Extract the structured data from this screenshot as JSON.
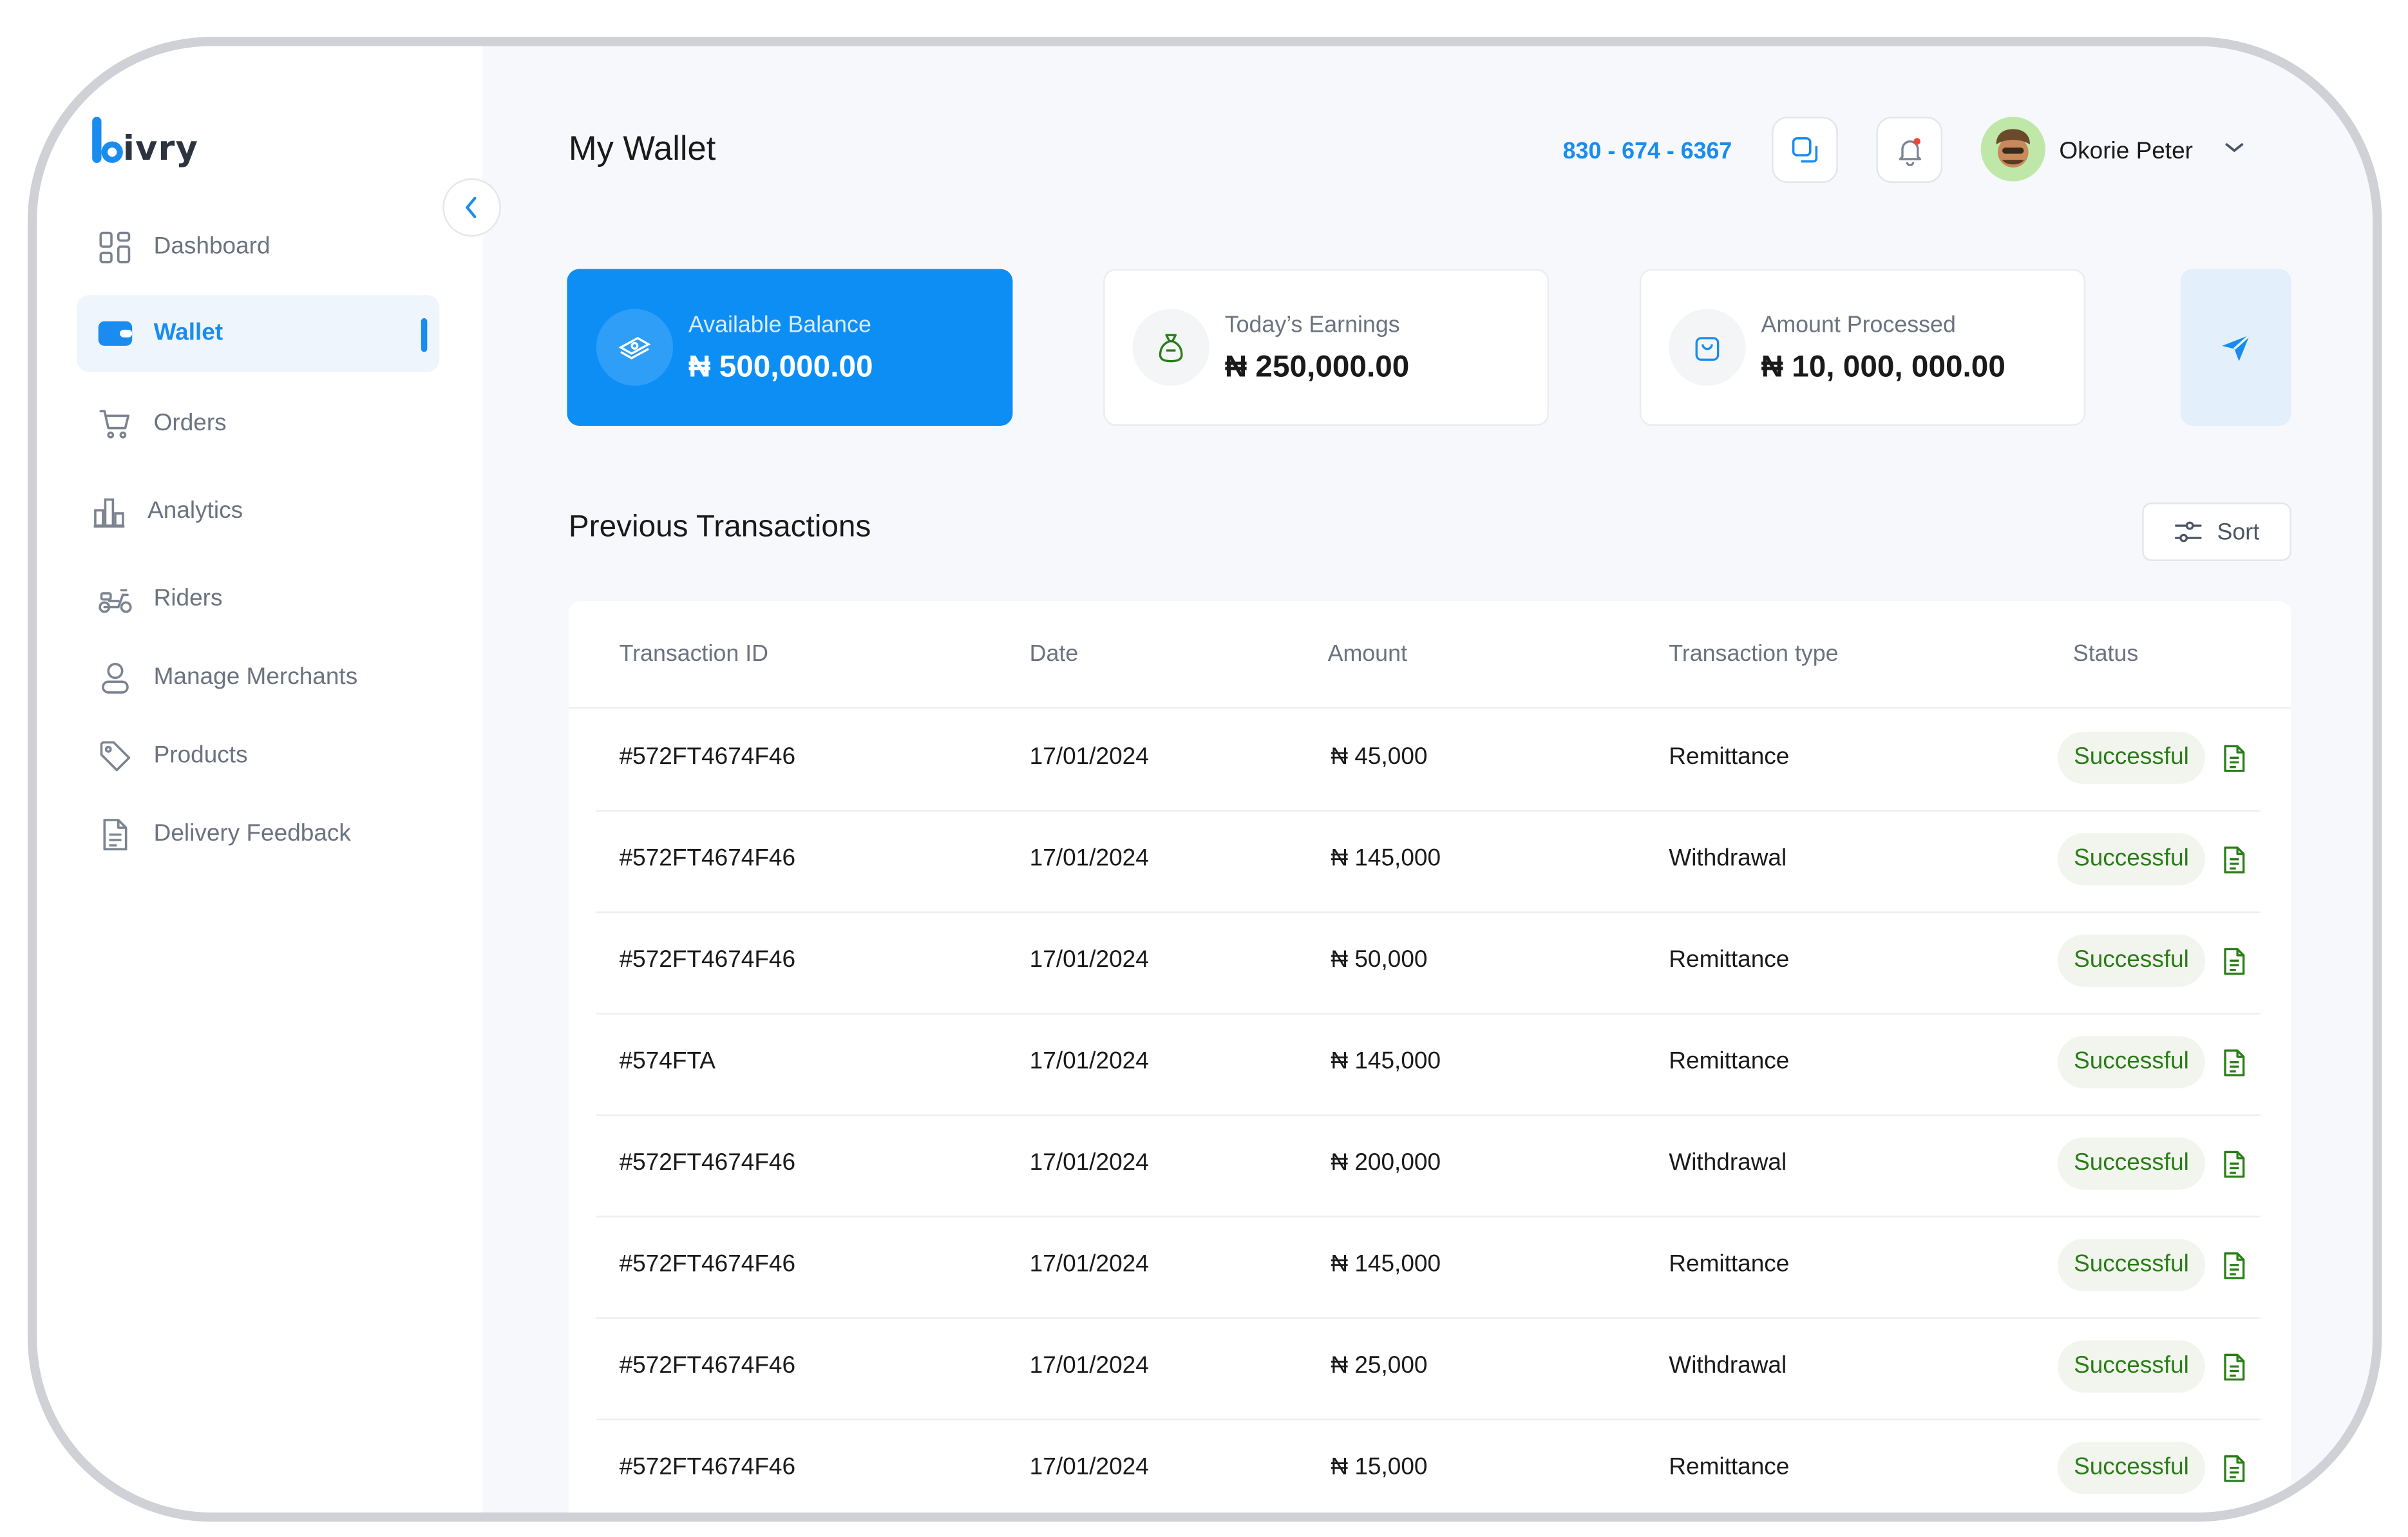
{
  "brand": {
    "name": "ivry",
    "accent": "#1a8cf0",
    "success": "#2a7d18"
  },
  "sidebar": {
    "items": [
      {
        "label": "Dashboard",
        "icon": "grid-icon",
        "active": false
      },
      {
        "label": "Wallet",
        "icon": "wallet-icon",
        "active": true
      },
      {
        "label": "Orders",
        "icon": "cart-icon",
        "active": false
      },
      {
        "label": "Analytics",
        "icon": "bar-chart-icon",
        "active": false
      },
      {
        "label": "Riders",
        "icon": "scooter-icon",
        "active": false
      },
      {
        "label": "Manage Merchants",
        "icon": "user-icon",
        "active": false
      },
      {
        "label": "Products",
        "icon": "tag-icon",
        "active": false
      },
      {
        "label": "Delivery Feedback",
        "icon": "document-icon",
        "active": false
      }
    ]
  },
  "header": {
    "title": "My Wallet",
    "phone": "830 - 674 - 6367",
    "user_name": "Okorie Peter"
  },
  "cards": [
    {
      "label": "Available Balance",
      "value": "₦ 500,000.00",
      "icon": "cash-icon"
    },
    {
      "label": "Today’s Earnings",
      "value": "₦ 250,000.00",
      "icon": "money-bag-icon"
    },
    {
      "label": "Amount Processed",
      "value": "₦ 10, 000, 000.00",
      "icon": "shopping-bag-icon"
    }
  ],
  "transactions": {
    "title": "Previous Transactions",
    "sort_label": "Sort",
    "columns": [
      "Transaction ID",
      "Date",
      "Amount",
      "Transaction type",
      "Status"
    ],
    "rows": [
      {
        "id": "#572FT4674F46",
        "date": "17/01/2024",
        "amount": "₦ 45,000",
        "type": "Remittance",
        "status": "Successful"
      },
      {
        "id": "#572FT4674F46",
        "date": "17/01/2024",
        "amount": "₦ 145,000",
        "type": "Withdrawal",
        "status": "Successful"
      },
      {
        "id": "#572FT4674F46",
        "date": "17/01/2024",
        "amount": "₦ 50,000",
        "type": "Remittance",
        "status": "Successful"
      },
      {
        "id": "#574FTA",
        "date": "17/01/2024",
        "amount": "₦ 145,000",
        "type": "Remittance",
        "status": "Successful"
      },
      {
        "id": "#572FT4674F46",
        "date": "17/01/2024",
        "amount": "₦ 200,000",
        "type": "Withdrawal",
        "status": "Successful"
      },
      {
        "id": "#572FT4674F46",
        "date": "17/01/2024",
        "amount": "₦ 145,000",
        "type": "Remittance",
        "status": "Successful"
      },
      {
        "id": "#572FT4674F46",
        "date": "17/01/2024",
        "amount": "₦ 25,000",
        "type": "Withdrawal",
        "status": "Successful"
      },
      {
        "id": "#572FT4674F46",
        "date": "17/01/2024",
        "amount": "₦ 15,000",
        "type": "Remittance",
        "status": "Successful"
      }
    ]
  }
}
